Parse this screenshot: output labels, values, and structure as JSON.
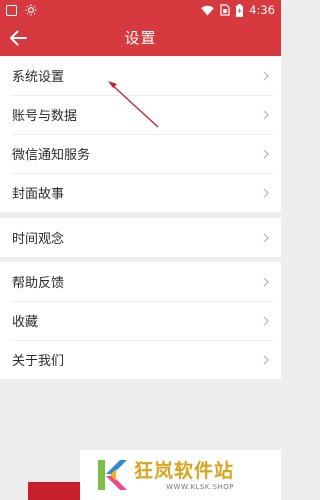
{
  "status_bar": {
    "time": "4:36",
    "icons": [
      "notification-square-icon",
      "brightness-icon",
      "wifi-icon",
      "sim-icon",
      "battery-icon"
    ]
  },
  "header": {
    "title": "设置",
    "back_icon": "arrow-left-icon"
  },
  "groups": [
    {
      "items": [
        {
          "label": "系统设置"
        },
        {
          "label": "账号与数据"
        },
        {
          "label": "微信通知服务"
        },
        {
          "label": "封面故事"
        }
      ]
    },
    {
      "items": [
        {
          "label": "时间观念"
        }
      ]
    },
    {
      "items": [
        {
          "label": "帮助反馈"
        },
        {
          "label": "收藏"
        },
        {
          "label": "关于我们"
        }
      ]
    }
  ],
  "watermark": {
    "title": "狂岚软件站",
    "url": "WWW.KLSK.SHOP"
  },
  "colors": {
    "brand_red": "#d6393e",
    "background": "#ededed",
    "annotation": "#c8202a",
    "watermark_gold": "#d9a51f"
  }
}
